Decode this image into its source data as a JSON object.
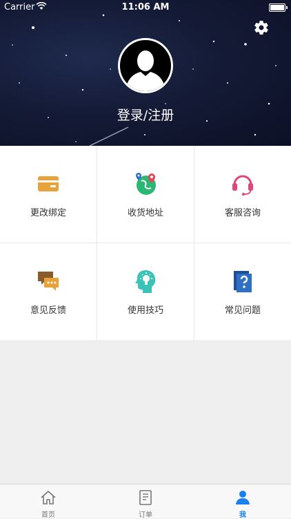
{
  "status_bar": {
    "carrier": "Carrier",
    "time": "11:06 AM"
  },
  "profile": {
    "login_label": "登录/注册"
  },
  "features": [
    {
      "label": "更改绑定",
      "icon": "card-icon",
      "color": "#e8a23c"
    },
    {
      "label": "收货地址",
      "icon": "map-location-icon",
      "color": "#2bb673"
    },
    {
      "label": "客服咨询",
      "icon": "headset-icon",
      "color": "#e0457b"
    },
    {
      "label": "意见反馈",
      "icon": "feedback-chat-icon",
      "color": "#e8a23c"
    },
    {
      "label": "使用技巧",
      "icon": "idea-head-icon",
      "color": "#3cc3b7"
    },
    {
      "label": "常见问题",
      "icon": "faq-document-icon",
      "color": "#2f6fc4"
    }
  ],
  "tabbar": {
    "tabs": [
      {
        "label": "首页",
        "icon": "home-icon"
      },
      {
        "label": "订单",
        "icon": "order-list-icon"
      },
      {
        "label": "我",
        "icon": "user-icon",
        "active": true
      }
    ],
    "active_color": "#1a7ff0"
  }
}
